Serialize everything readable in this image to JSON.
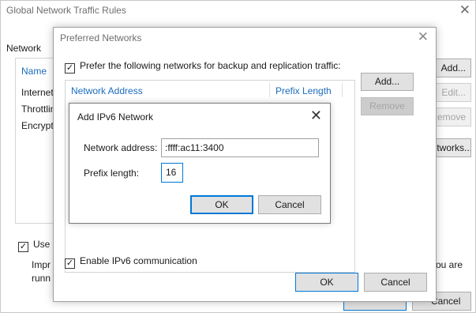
{
  "main_window": {
    "title": "Global Network Traffic Rules",
    "close_glyph": "✕",
    "network_label": "Network",
    "list": {
      "header": "Name",
      "rows": [
        "Internet",
        "Throttlin",
        "Encrypti"
      ]
    },
    "buttons": {
      "add": "Add...",
      "edit": "Edit...",
      "remove": "Remove",
      "networks": "Networks..."
    },
    "use_checkbox_label": "Use r",
    "use_checkbox_checked": true,
    "info_line1_left": "Impr",
    "info_line2_left": "runn",
    "info_line1_right": "you are",
    "cancel_button": "Cancel"
  },
  "preferred_window": {
    "title": "Preferred Networks",
    "close_glyph": "✕",
    "prefer_checkbox_label": "Prefer the following networks for backup and replication traffic:",
    "prefer_checked": true,
    "columns": [
      "Network Address",
      "Prefix Length"
    ],
    "add_button": "Add...",
    "remove_button": "Remove",
    "enable_ipv6_label": "Enable IPv6 communication",
    "enable_ipv6_checked": true,
    "ok_button": "OK",
    "cancel_button": "Cancel"
  },
  "add_ipv6_window": {
    "title": "Add IPv6 Network",
    "close_glyph": "✕",
    "network_address_label": "Network address:",
    "network_address_value": ":ffff:ac11:3400",
    "prefix_length_label": "Prefix length:",
    "prefix_length_value": "16",
    "ok_button": "OK",
    "cancel_button": "Cancel"
  },
  "colors": {
    "accent_blue": "#0078d7",
    "header_blue": "#1b6dbd",
    "disabled_text": "#a4a4a4"
  }
}
